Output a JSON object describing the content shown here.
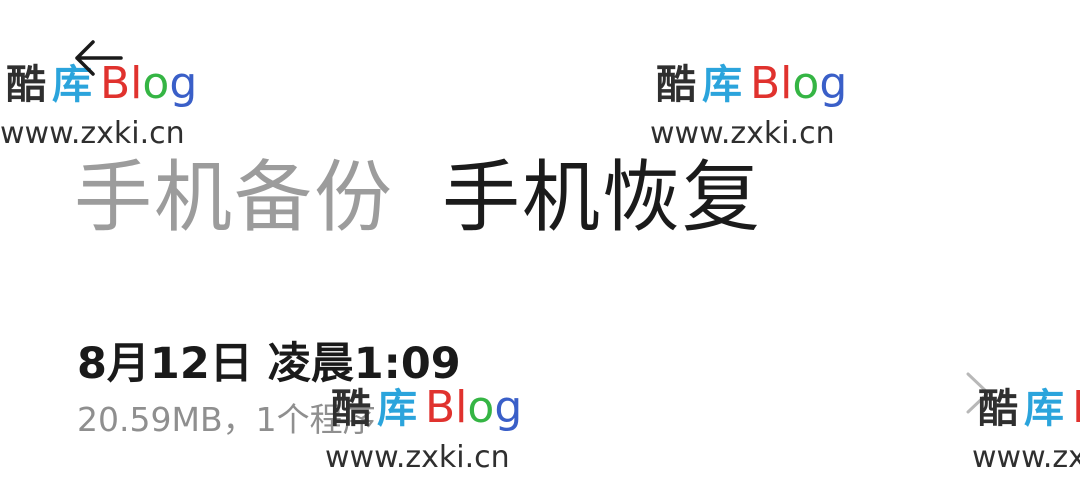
{
  "header": {
    "back_icon": "back-arrow-icon"
  },
  "tabs": [
    {
      "label": "手机备份",
      "active": false
    },
    {
      "label": "手机恢复",
      "active": true
    }
  ],
  "backup_list": [
    {
      "title": "8月12日 凌晨1:09",
      "subtitle": "20.59MB，1个程序",
      "chevron_icon": "chevron-right-icon"
    }
  ],
  "watermark": {
    "logo_cn_1": "酷",
    "logo_cn_2": "库",
    "logo_b": "Bl",
    "logo_o": "o",
    "logo_g": "g",
    "url": "www.zxki.cn",
    "colors": {
      "cn1": "#2f2f2f",
      "cn2": "#2ba4dc",
      "b": "#e0322e",
      "o": "#35b544",
      "g": "#3a5fc8"
    }
  },
  "colors": {
    "active_tab": "#1b1b1b",
    "inactive_tab": "#9c9c9c",
    "title": "#1a1a1a",
    "subtitle": "#8f8f8f",
    "chevron": "#b8b8b8"
  }
}
